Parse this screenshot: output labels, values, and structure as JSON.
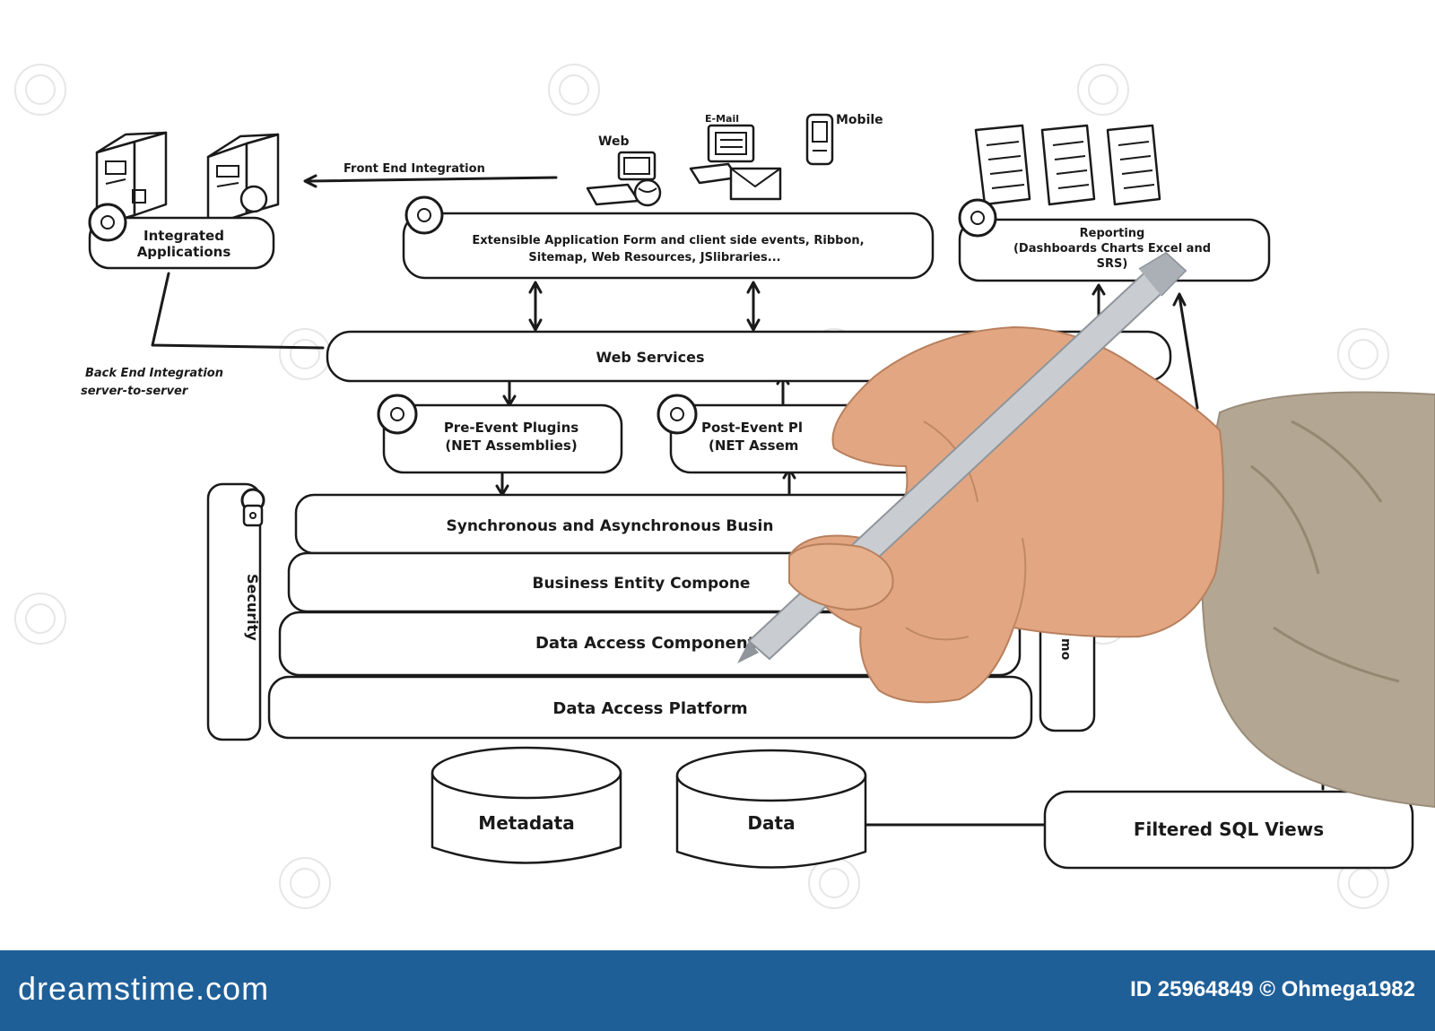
{
  "diagram": {
    "front_end_integration": "Front End Integration",
    "back_end_integration_line1": "Back End Integration",
    "back_end_integration_line2": "server-to-server",
    "integrated_applications_line1": "Integrated",
    "integrated_applications_line2": "Applications",
    "web": "Web",
    "email": "E-Mail",
    "mobile": "Mobile",
    "extensible_line1": "Extensible Application   Form and client side events, Ribbon,",
    "extensible_line2": "Sitemap, Web Resources, JSlibraries...",
    "reporting_line1": "Reporting",
    "reporting_line2": "(Dashboards  Charts  Excel and",
    "reporting_line3": "SRS)",
    "web_services": "Web Services",
    "pre_event_line1": "Pre-Event Plugins",
    "pre_event_line2": "(NET Assemblies)",
    "post_event_line1": "Post-Event Pl",
    "post_event_line2": "(NET Assem",
    "security": "Security",
    "sync_async": "Synchronous and Asynchronous Busin",
    "business_entity": "Business Entity Compone",
    "data_access_components": "Data Access Components",
    "data_access_platform": "Data Access Platform",
    "metadata": "Metadata",
    "data": "Data",
    "filtered_sql_views": "Filtered SQL Views",
    "side_partial": "mo"
  },
  "footer": {
    "brand": "dreamstime.com",
    "credit": "ID 25964849 © Ohmega1982"
  },
  "colors": {
    "footer_bg": "#1f5f98",
    "ink": "#1a1a1a",
    "sleeve": "#b3a692",
    "skin": "#e2a782",
    "pen": "#c9cdd1"
  }
}
